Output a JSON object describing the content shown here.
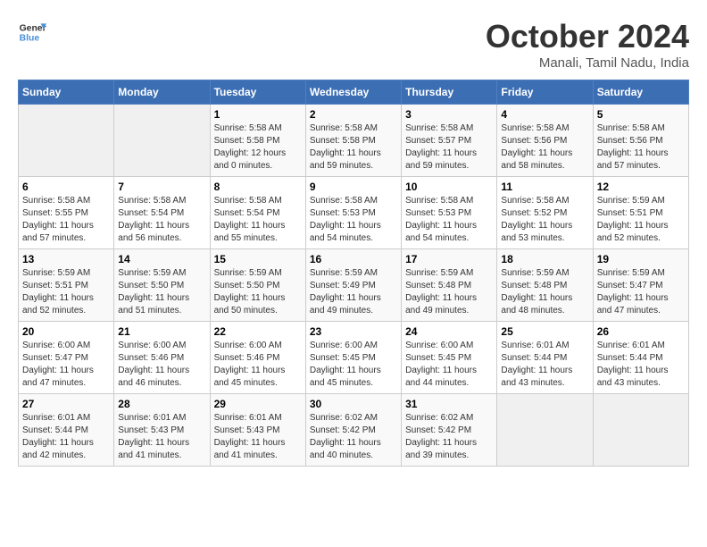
{
  "logo": {
    "line1": "General",
    "line2": "Blue"
  },
  "title": "October 2024",
  "subtitle": "Manali, Tamil Nadu, India",
  "days_header": [
    "Sunday",
    "Monday",
    "Tuesday",
    "Wednesday",
    "Thursday",
    "Friday",
    "Saturday"
  ],
  "weeks": [
    [
      {
        "day": "",
        "info": ""
      },
      {
        "day": "",
        "info": ""
      },
      {
        "day": "1",
        "info": "Sunrise: 5:58 AM\nSunset: 5:58 PM\nDaylight: 12 hours\nand 0 minutes."
      },
      {
        "day": "2",
        "info": "Sunrise: 5:58 AM\nSunset: 5:58 PM\nDaylight: 11 hours\nand 59 minutes."
      },
      {
        "day": "3",
        "info": "Sunrise: 5:58 AM\nSunset: 5:57 PM\nDaylight: 11 hours\nand 59 minutes."
      },
      {
        "day": "4",
        "info": "Sunrise: 5:58 AM\nSunset: 5:56 PM\nDaylight: 11 hours\nand 58 minutes."
      },
      {
        "day": "5",
        "info": "Sunrise: 5:58 AM\nSunset: 5:56 PM\nDaylight: 11 hours\nand 57 minutes."
      }
    ],
    [
      {
        "day": "6",
        "info": "Sunrise: 5:58 AM\nSunset: 5:55 PM\nDaylight: 11 hours\nand 57 minutes."
      },
      {
        "day": "7",
        "info": "Sunrise: 5:58 AM\nSunset: 5:54 PM\nDaylight: 11 hours\nand 56 minutes."
      },
      {
        "day": "8",
        "info": "Sunrise: 5:58 AM\nSunset: 5:54 PM\nDaylight: 11 hours\nand 55 minutes."
      },
      {
        "day": "9",
        "info": "Sunrise: 5:58 AM\nSunset: 5:53 PM\nDaylight: 11 hours\nand 54 minutes."
      },
      {
        "day": "10",
        "info": "Sunrise: 5:58 AM\nSunset: 5:53 PM\nDaylight: 11 hours\nand 54 minutes."
      },
      {
        "day": "11",
        "info": "Sunrise: 5:58 AM\nSunset: 5:52 PM\nDaylight: 11 hours\nand 53 minutes."
      },
      {
        "day": "12",
        "info": "Sunrise: 5:59 AM\nSunset: 5:51 PM\nDaylight: 11 hours\nand 52 minutes."
      }
    ],
    [
      {
        "day": "13",
        "info": "Sunrise: 5:59 AM\nSunset: 5:51 PM\nDaylight: 11 hours\nand 52 minutes."
      },
      {
        "day": "14",
        "info": "Sunrise: 5:59 AM\nSunset: 5:50 PM\nDaylight: 11 hours\nand 51 minutes."
      },
      {
        "day": "15",
        "info": "Sunrise: 5:59 AM\nSunset: 5:50 PM\nDaylight: 11 hours\nand 50 minutes."
      },
      {
        "day": "16",
        "info": "Sunrise: 5:59 AM\nSunset: 5:49 PM\nDaylight: 11 hours\nand 49 minutes."
      },
      {
        "day": "17",
        "info": "Sunrise: 5:59 AM\nSunset: 5:48 PM\nDaylight: 11 hours\nand 49 minutes."
      },
      {
        "day": "18",
        "info": "Sunrise: 5:59 AM\nSunset: 5:48 PM\nDaylight: 11 hours\nand 48 minutes."
      },
      {
        "day": "19",
        "info": "Sunrise: 5:59 AM\nSunset: 5:47 PM\nDaylight: 11 hours\nand 47 minutes."
      }
    ],
    [
      {
        "day": "20",
        "info": "Sunrise: 6:00 AM\nSunset: 5:47 PM\nDaylight: 11 hours\nand 47 minutes."
      },
      {
        "day": "21",
        "info": "Sunrise: 6:00 AM\nSunset: 5:46 PM\nDaylight: 11 hours\nand 46 minutes."
      },
      {
        "day": "22",
        "info": "Sunrise: 6:00 AM\nSunset: 5:46 PM\nDaylight: 11 hours\nand 45 minutes."
      },
      {
        "day": "23",
        "info": "Sunrise: 6:00 AM\nSunset: 5:45 PM\nDaylight: 11 hours\nand 45 minutes."
      },
      {
        "day": "24",
        "info": "Sunrise: 6:00 AM\nSunset: 5:45 PM\nDaylight: 11 hours\nand 44 minutes."
      },
      {
        "day": "25",
        "info": "Sunrise: 6:01 AM\nSunset: 5:44 PM\nDaylight: 11 hours\nand 43 minutes."
      },
      {
        "day": "26",
        "info": "Sunrise: 6:01 AM\nSunset: 5:44 PM\nDaylight: 11 hours\nand 43 minutes."
      }
    ],
    [
      {
        "day": "27",
        "info": "Sunrise: 6:01 AM\nSunset: 5:44 PM\nDaylight: 11 hours\nand 42 minutes."
      },
      {
        "day": "28",
        "info": "Sunrise: 6:01 AM\nSunset: 5:43 PM\nDaylight: 11 hours\nand 41 minutes."
      },
      {
        "day": "29",
        "info": "Sunrise: 6:01 AM\nSunset: 5:43 PM\nDaylight: 11 hours\nand 41 minutes."
      },
      {
        "day": "30",
        "info": "Sunrise: 6:02 AM\nSunset: 5:42 PM\nDaylight: 11 hours\nand 40 minutes."
      },
      {
        "day": "31",
        "info": "Sunrise: 6:02 AM\nSunset: 5:42 PM\nDaylight: 11 hours\nand 39 minutes."
      },
      {
        "day": "",
        "info": ""
      },
      {
        "day": "",
        "info": ""
      }
    ]
  ]
}
